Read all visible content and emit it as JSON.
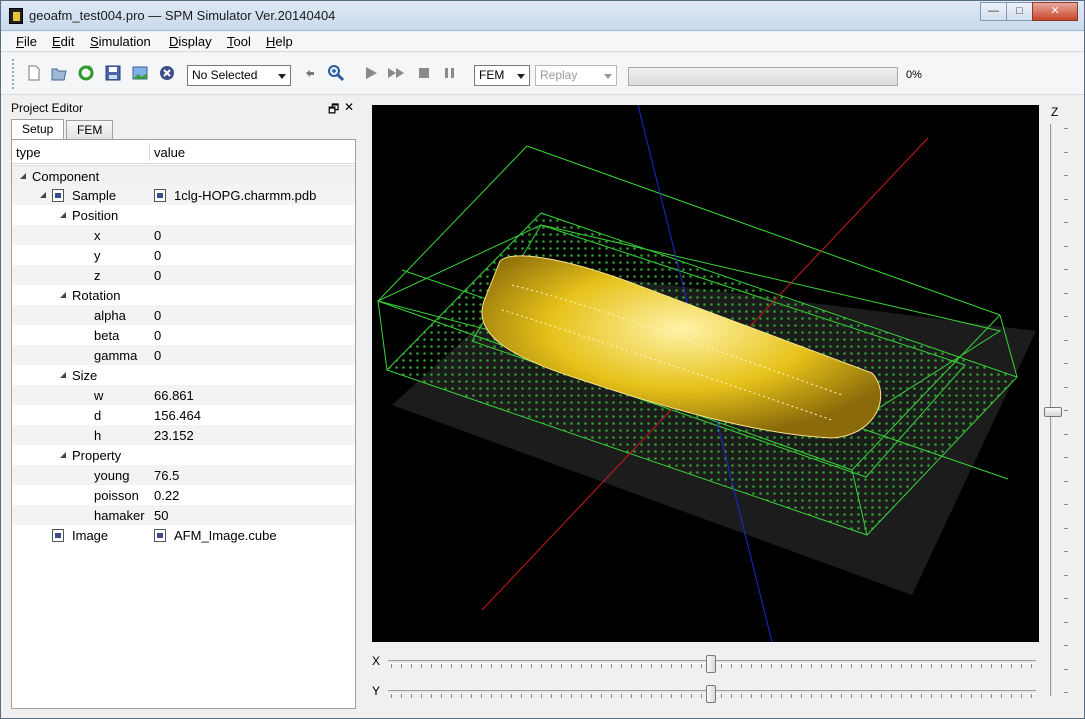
{
  "window": {
    "title": "geoafm_test004.pro — SPM Simulator Ver.20140404",
    "minimize": "—",
    "maximize": "□",
    "close": "✕"
  },
  "menu": [
    "File",
    "Edit",
    "Simulation",
    "Display",
    "Tool",
    "Help"
  ],
  "toolbar": {
    "model_select": "No Selected",
    "mode_select": "FEM",
    "replay_select": "Replay",
    "progress": 0,
    "progress_label": "0%"
  },
  "panel": {
    "title": "Project Editor",
    "float_icon": "🗗",
    "close_icon": "✕",
    "tabs": [
      "Setup",
      "FEM"
    ],
    "columns": {
      "type": "type",
      "value": "value"
    },
    "rows": [
      {
        "type": "Component",
        "value": ""
      },
      {
        "type": "Sample",
        "value": "1clg-HOPG.charmm.pdb"
      },
      {
        "type": "Position",
        "value": ""
      },
      {
        "type": "x",
        "value": "0"
      },
      {
        "type": "y",
        "value": "0"
      },
      {
        "type": "z",
        "value": "0"
      },
      {
        "type": "Rotation",
        "value": ""
      },
      {
        "type": "alpha",
        "value": "0"
      },
      {
        "type": "beta",
        "value": "0"
      },
      {
        "type": "gamma",
        "value": "0"
      },
      {
        "type": "Size",
        "value": ""
      },
      {
        "type": "w",
        "value": "66.861"
      },
      {
        "type": "d",
        "value": "156.464"
      },
      {
        "type": "h",
        "value": "23.152"
      },
      {
        "type": "Property",
        "value": ""
      },
      {
        "type": "young",
        "value": "76.5"
      },
      {
        "type": "poisson",
        "value": "0.22"
      },
      {
        "type": "hamaker",
        "value": "50"
      },
      {
        "type": "Image",
        "value": "AFM_Image.cube"
      }
    ]
  },
  "view": {
    "z_label": "Z",
    "x_label": "X",
    "y_label": "Y",
    "z_level": 0.5,
    "x_level": 0.5,
    "y_level": 0.5,
    "colors": {
      "box": "#39d439",
      "axis_x": "#cc1a1a",
      "axis_y": "#1a2ad6",
      "molecule": "#e8c81a",
      "grid_dot": "#2e9e2e"
    }
  }
}
